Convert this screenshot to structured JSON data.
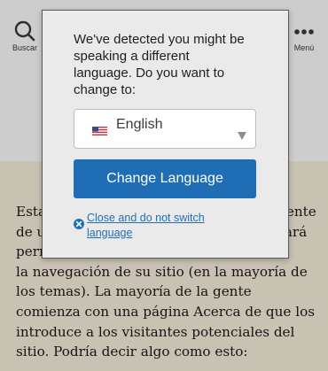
{
  "header": {
    "search": {
      "label": "Buscar",
      "icon": "search-icon"
    },
    "menu": {
      "label": "Menú",
      "icon": "menu-dots-icon"
    }
  },
  "content": {
    "paragraph": "Esta es una página de ejemplo. Es diferente\nde una entrada de blog porque se quedará\npermanente en un lugar y aparecerá en\nla navegación de su sitio (en la mayoría de\nlos temas). La mayoría de la gente\ncomienza con una página Acerca de que los\nintroduce a los visitantes potenciales del\nsitio. Podría decir algo como esto:"
  },
  "language_modal": {
    "prompt": "We've detected you might be\nspeaking a different\nlanguage. Do you want to\nchange to:",
    "select": {
      "value": "English",
      "flag_icon": "us-flag-icon",
      "caret_icon": "chevron-down-icon"
    },
    "change_button": "Change Language",
    "close_link": "Close and do not switch\nlanguage",
    "close_icon": "close-circle-icon"
  },
  "colors": {
    "accent": "#1f6eb5",
    "modal_bg": "#eaeaea",
    "header_bg": "#cdcdcd",
    "content_bg": "#c8c2b3"
  }
}
